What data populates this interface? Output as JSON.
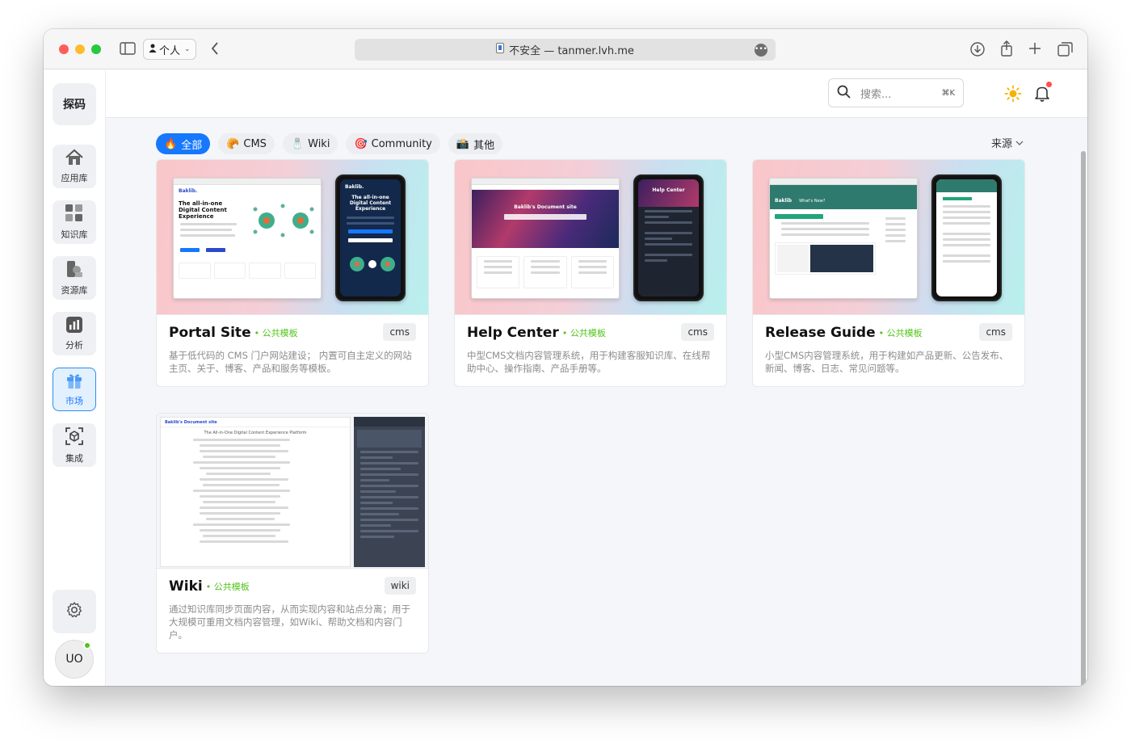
{
  "browser": {
    "profile_label": "个人",
    "address": "不安全 — tanmer.lvh.me"
  },
  "sidebar": {
    "logo": "探码",
    "items": [
      {
        "label": "应用库",
        "icon": "home-icon"
      },
      {
        "label": "知识库",
        "icon": "grid-icon"
      },
      {
        "label": "资源库",
        "icon": "resource-icon"
      },
      {
        "label": "分析",
        "icon": "chart-icon"
      },
      {
        "label": "市场",
        "icon": "gift-icon",
        "active": true
      },
      {
        "label": "集成",
        "icon": "integration-icon"
      }
    ],
    "avatar_initials": "UO"
  },
  "header": {
    "search_placeholder": "搜索...",
    "search_shortcut": "⌘K"
  },
  "filters": [
    {
      "emoji": "🔥",
      "label": "全部",
      "active": true
    },
    {
      "emoji": "🥐",
      "label": "CMS"
    },
    {
      "emoji": "🧂",
      "label": "Wiki"
    },
    {
      "emoji": "🎯",
      "label": "Community"
    },
    {
      "emoji": "📸",
      "label": "其他"
    }
  ],
  "source_label": "来源",
  "templates": [
    {
      "title": "Portal Site",
      "badge": "公共模板",
      "tag": "cms",
      "description": "基于低代码的 CMS 门户网站建设；  内置可自主定义的网站主页、关于、博客、产品和服务等模板。",
      "preview": {
        "headline": "The all-in-one Digital Content Experience",
        "phone_headline": "The all-in-one Digital Content Experience",
        "brand": "Baklib."
      }
    },
    {
      "title": "Help Center",
      "badge": "公共模板",
      "tag": "cms",
      "description": "中型CMS文档内容管理系统，用于构建客服知识库、在线帮助中心、操作指南、产品手册等。",
      "preview": {
        "headline": "Baklib's Document site",
        "phone_headline": "Help Center"
      }
    },
    {
      "title": "Release Guide",
      "badge": "公共模板",
      "tag": "cms",
      "description": "小型CMS内容管理系统，用于构建如产品更新、公告发布、新闻、博客、日志、常见问题等。",
      "preview": {
        "headline": "What's New?",
        "brand": "Baklib"
      }
    },
    {
      "title": "Wiki",
      "badge": "公共模板",
      "tag": "wiki",
      "description": "通过知识库同步页面内容，从而实现内容和站点分离；用于大规模可重用文档内容管理，如Wiki、帮助文档和内容门户。",
      "preview": {
        "headline": "Baklib's Document site",
        "subheadline": "The All-in-One Digital Content Experience Platform"
      }
    }
  ]
}
